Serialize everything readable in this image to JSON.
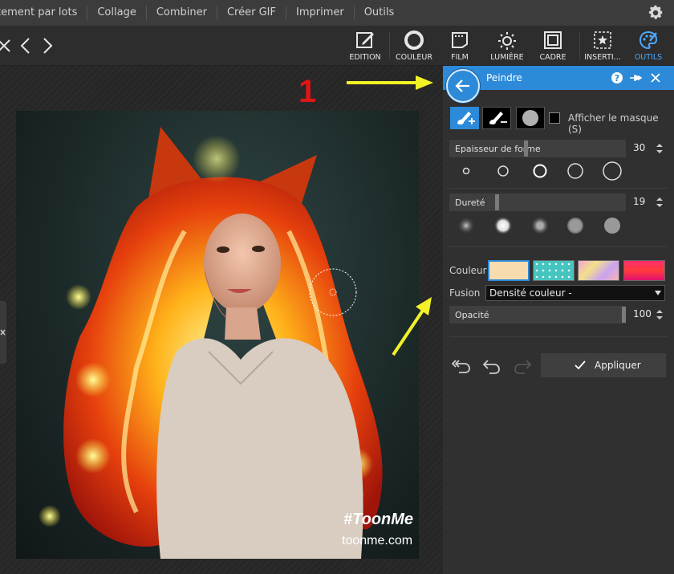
{
  "menu": {
    "items": [
      "tement par lots",
      "Collage",
      "Combiner",
      "Créer GIF",
      "Imprimer",
      "Outils"
    ]
  },
  "toolbar": {
    "tools": [
      {
        "label": "EDITION",
        "icon": "pencil-box-icon"
      },
      {
        "label": "COULEUR",
        "icon": "circle-ring-icon"
      },
      {
        "label": "FILM",
        "icon": "film-icon"
      },
      {
        "label": "LUMIÈRE",
        "icon": "sun-icon"
      },
      {
        "label": "CADRE",
        "icon": "frame-icon"
      },
      {
        "label": "INSERTI...",
        "icon": "star-frame-icon"
      },
      {
        "label": "OUTILS",
        "icon": "palette-icon"
      }
    ],
    "active": "OUTILS"
  },
  "canvas": {
    "annotation_number": "1",
    "watermark_tag": "#ToonMe",
    "watermark_site": "toonme.com"
  },
  "panel": {
    "title": "Peindre",
    "show_mask_label": "Afficher le masque (S)",
    "thickness": {
      "label": "Epaisseur de forme",
      "value": "30",
      "level": 0.3
    },
    "hardness": {
      "label": "Dureté",
      "value": "19",
      "level": 0.19
    },
    "color_label": "Couleur",
    "blend_label": "Fusion",
    "blend_value": "Densité couleur -",
    "opacity": {
      "label": "Opacité",
      "value": "100",
      "level": 1.0
    },
    "apply_label": "Appliquer"
  },
  "colors": {
    "accent": "#2c8ad9",
    "arrow": "#f2f226",
    "marker": "#e01515"
  }
}
